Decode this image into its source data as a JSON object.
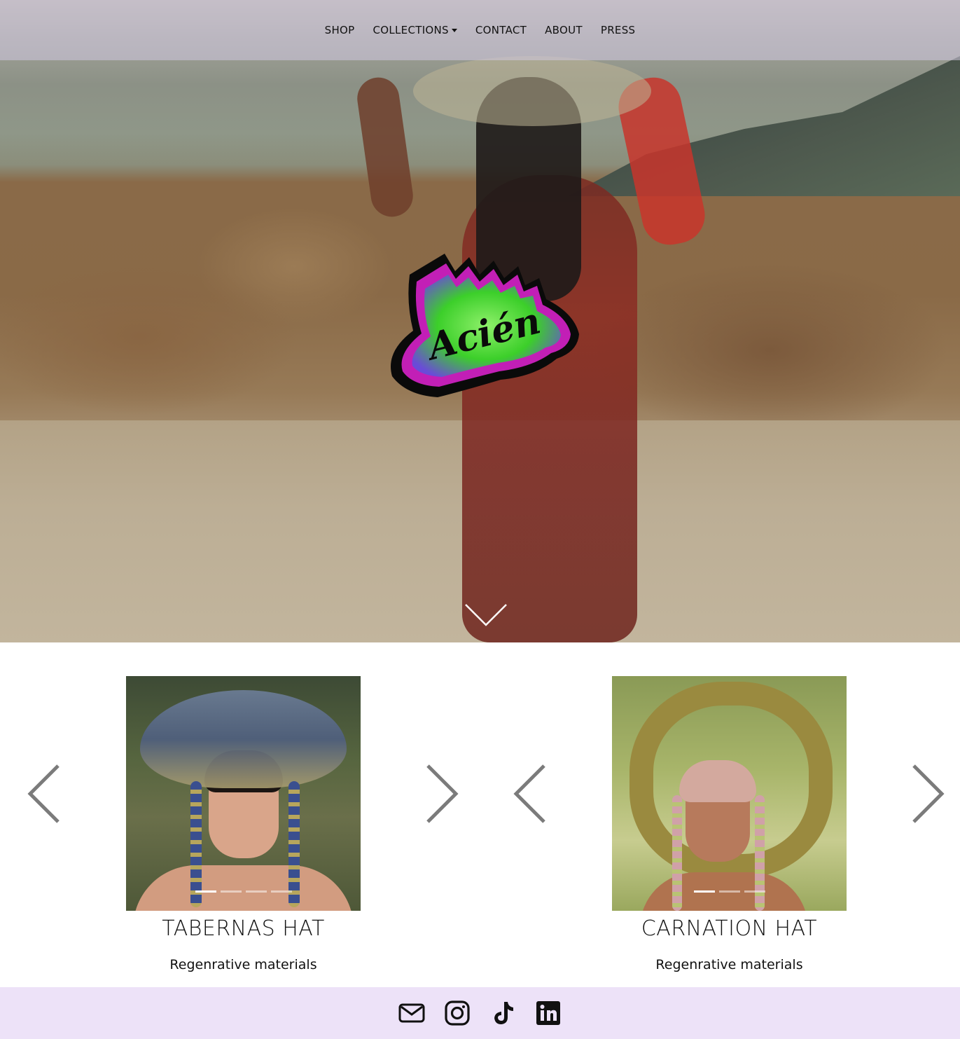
{
  "nav": {
    "items": [
      {
        "label": "SHOP",
        "dropdown": false
      },
      {
        "label": "COLLECTIONS",
        "dropdown": true
      },
      {
        "label": "CONTACT",
        "dropdown": false
      },
      {
        "label": "ABOUT",
        "dropdown": false
      },
      {
        "label": "PRESS",
        "dropdown": false
      }
    ]
  },
  "hero": {
    "logo_text": "Acién",
    "logo_icon": "acien-logo",
    "scroll_icon": "chevron-down-icon"
  },
  "products": [
    {
      "title": "TABERNAS HAT",
      "subtitle": "Regenrative materials",
      "slides": 4,
      "active_slide": 1
    },
    {
      "title": "CARNATION HAT",
      "subtitle": "Regenrative materials",
      "slides": 3,
      "active_slide": 1
    }
  ],
  "footer": {
    "icons": [
      "envelope-icon",
      "instagram-icon",
      "tiktok-icon",
      "linkedin-icon"
    ]
  },
  "colors": {
    "nav_bg": "#d2c8e1",
    "footer_bg": "#ede2f8",
    "logo_green": "#3ccf2a",
    "logo_magenta": "#c21fb6",
    "arrow_gray": "#7b7b7b"
  }
}
